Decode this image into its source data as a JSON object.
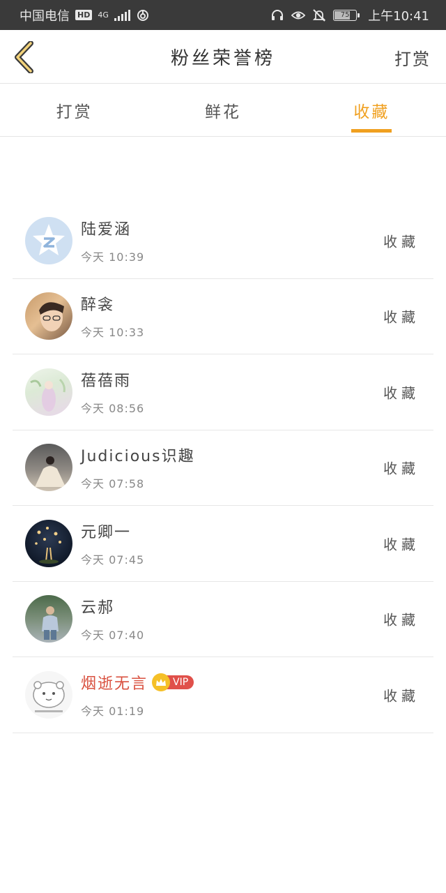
{
  "status_bar": {
    "carrier": "中国电信",
    "hd": "HD",
    "network": "4G",
    "battery": "75",
    "battery_level": 0.75,
    "time": "上午10:41"
  },
  "header": {
    "title": "粉丝荣誉榜",
    "action": "打赏"
  },
  "tabs": [
    {
      "label": "打赏",
      "active": false
    },
    {
      "label": "鲜花",
      "active": false
    },
    {
      "label": "收藏",
      "active": true
    }
  ],
  "accent_color": "#f0a020",
  "fans": [
    {
      "name": "陆爱涵",
      "time": "今天 10:39",
      "type": "收藏",
      "vip": false
    },
    {
      "name": "醉衾",
      "time": "今天 10:33",
      "type": "收藏",
      "vip": false
    },
    {
      "name": "蓓蓓雨",
      "time": "今天 08:56",
      "type": "收藏",
      "vip": false
    },
    {
      "name": "Judicious识趣",
      "time": "今天 07:58",
      "type": "收藏",
      "vip": false
    },
    {
      "name": "元卿一",
      "time": "今天 07:45",
      "type": "收藏",
      "vip": false
    },
    {
      "name": "云郝",
      "time": "今天 07:40",
      "type": "收藏",
      "vip": false
    },
    {
      "name": "烟逝无言",
      "time": "今天 01:19",
      "type": "收藏",
      "vip": true,
      "vip_label": "VIP"
    }
  ]
}
